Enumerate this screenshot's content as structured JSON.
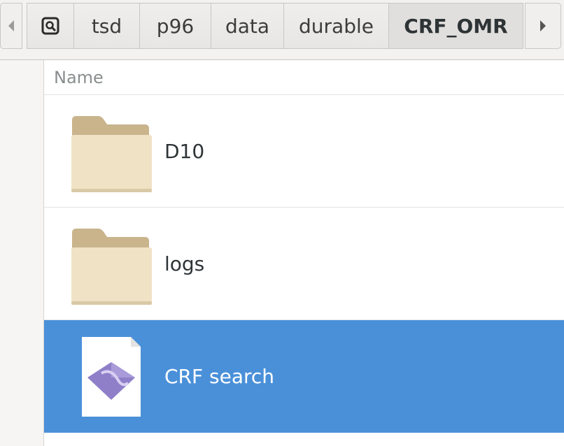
{
  "pathbar": {
    "crumbs": [
      "tsd",
      "p96",
      "data",
      "durable",
      "CRF_OMR"
    ],
    "active_index": 4
  },
  "list": {
    "column_name": "Name",
    "items": [
      {
        "label": "D10",
        "type": "folder"
      },
      {
        "label": "logs",
        "type": "folder"
      },
      {
        "label": "CRF search",
        "type": "desktop-file",
        "selected": true
      }
    ]
  },
  "colors": {
    "selection": "#4a90d9",
    "folder_front": "#f0e2c5",
    "folder_back": "#c9b48c",
    "launcher_icon": "#8f7fc9"
  }
}
